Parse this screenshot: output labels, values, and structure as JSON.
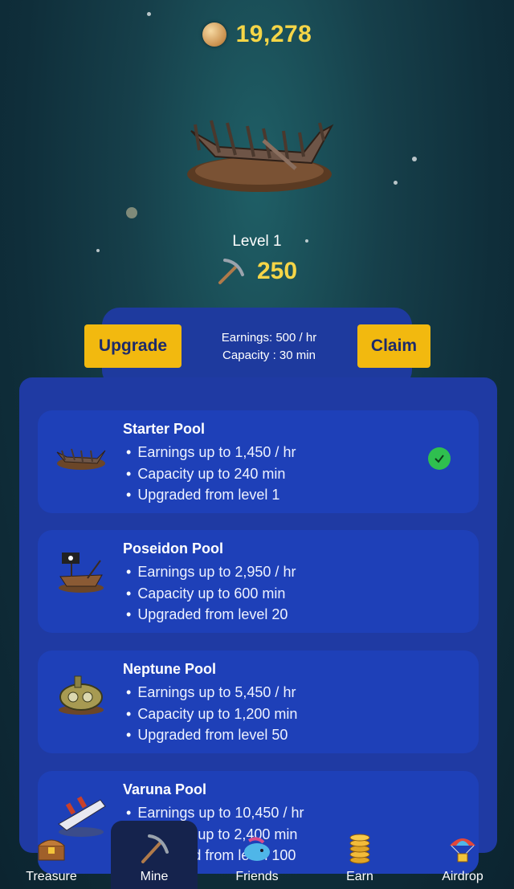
{
  "header": {
    "coin_balance": "19,278",
    "coin_icon": "coin-icon"
  },
  "mine": {
    "level_label": "Level 1",
    "pickaxe_value": "250",
    "upgrade_label": "Upgrade",
    "claim_label": "Claim",
    "earnings_text": "Earnings: 500 / hr",
    "capacity_text": "Capacity : 30 min"
  },
  "pools": [
    {
      "title": "Starter Pool",
      "lines": [
        "Earnings up to 1,450 / hr",
        "Capacity up to 240 min",
        "Upgraded from level 1"
      ],
      "completed": true,
      "icon": "shipwreck-icon"
    },
    {
      "title": "Poseidon Pool",
      "lines": [
        "Earnings up to 2,950 / hr",
        "Capacity up to 600 min",
        "Upgraded from level 20"
      ],
      "completed": false,
      "icon": "pirate-ship-icon"
    },
    {
      "title": "Neptune Pool",
      "lines": [
        "Earnings up to 5,450 / hr",
        "Capacity up to 1,200 min",
        "Upgraded from level 50"
      ],
      "completed": false,
      "icon": "submarine-icon"
    },
    {
      "title": "Varuna Pool",
      "lines": [
        "Earnings up to 10,450 / hr",
        "Capacity up to 2,400 min",
        "Upgraded from level 100"
      ],
      "completed": false,
      "icon": "sinking-ship-icon"
    }
  ],
  "nav": [
    {
      "label": "Treasure",
      "icon": "treasure-chest-icon"
    },
    {
      "label": "Mine",
      "icon": "pickaxe-icon",
      "active": true
    },
    {
      "label": "Friends",
      "icon": "whale-icon"
    },
    {
      "label": "Earn",
      "icon": "coin-stack-icon"
    },
    {
      "label": "Airdrop",
      "icon": "parachute-icon"
    }
  ],
  "colors": {
    "accent": "#f5d547",
    "button": "#f2b90f",
    "panel": "#1f3aa3",
    "card": "#1e40b8",
    "check": "#2fbf4f"
  }
}
